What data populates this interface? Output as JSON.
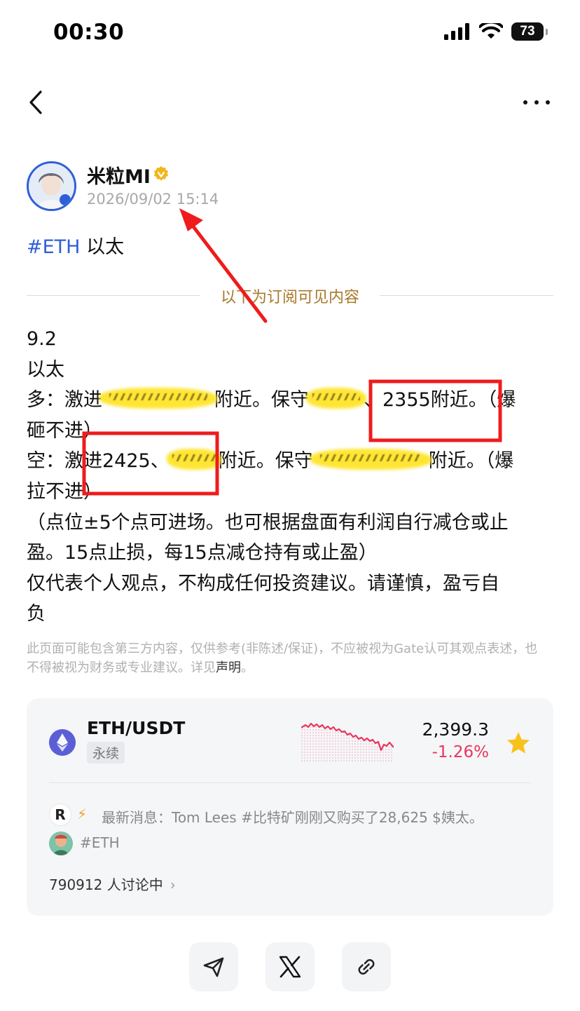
{
  "status_bar": {
    "time": "00:30",
    "battery": "73"
  },
  "author": {
    "name": "米粒MI",
    "time": "2026/09/02 15:14"
  },
  "post": {
    "tag": "#ETH",
    "tag_suffix": " 以太",
    "divider_text": "以下为订阅可见内容",
    "lines": {
      "l1": "9.2",
      "l2": "以太",
      "l3a": "多：激进",
      "l3b": "附近。保守",
      "l3c": "、2355附近。（爆",
      "l4": "砸不进）",
      "l5a": "空：激进2425、",
      "l5b": "附近。保守",
      "l5c": "附近。（爆",
      "l6": "拉不进）",
      "l7": "（点位±5个点可进场。也可根据盘面有利润自行减仓或止",
      "l8": "盈。15点止损，每15点减仓持有或止盈）",
      "l9": "仅代表个人观点，不构成任何投资建议。请谨慎，盈亏自",
      "l10": "负"
    }
  },
  "disclaimer": {
    "text": "此页面可能包含第三方内容，仅供参考(非陈述/保证)，不应被视为Gate认可其观点表述，也不得被视为财务或专业建议。详见",
    "link": "声明",
    "end": "。"
  },
  "market": {
    "pair": "ETH/USDT",
    "type": "永续",
    "price": "2,399.3",
    "change": "-1.26%",
    "trend_color": "#e8365d",
    "news_logo": "R",
    "news_text": "最新消息：Tom Lees #比特矿刚刚又购买了28,625 $姨太。",
    "tag": "#ETH",
    "discuss": "790912 人讨论中"
  },
  "icons": {
    "back": "chevron-left-icon",
    "more": "more-dots-icon",
    "verified": "verified-badge-icon",
    "star": "star-icon",
    "share": [
      "send-icon",
      "x-icon",
      "link-icon"
    ]
  }
}
